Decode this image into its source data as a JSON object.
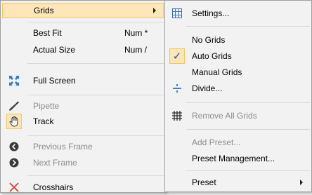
{
  "main_menu": {
    "items": [
      {
        "label": "Grids"
      },
      {
        "label": "Best Fit",
        "shortcut": "Num *"
      },
      {
        "label": "Actual Size",
        "shortcut": "Num /"
      },
      {
        "label": "Full Screen",
        "icon": "fullscreen-icon"
      },
      {
        "label": "Pipette",
        "icon": "pipette-icon",
        "disabled": true
      },
      {
        "label": "Track",
        "icon": "hand-icon"
      },
      {
        "label": "Previous Frame",
        "icon": "previous-frame-icon",
        "disabled": true
      },
      {
        "label": "Next Frame",
        "icon": "next-frame-icon",
        "disabled": true
      },
      {
        "label": "Crosshairs",
        "icon": "crosshairs-icon"
      }
    ]
  },
  "grids_submenu": {
    "items": [
      {
        "label": "Settings...",
        "icon": "grid-settings-icon"
      },
      {
        "label": "No Grids"
      },
      {
        "label": "Auto Grids",
        "checked": true,
        "check_symbol": "✓"
      },
      {
        "label": "Manual Grids"
      },
      {
        "label": "Divide...",
        "icon": "divide-icon"
      },
      {
        "label": "Remove All Grids",
        "icon": "remove-grids-icon",
        "disabled": true
      },
      {
        "label": "Add Preset...",
        "disabled": true
      },
      {
        "label": "Preset Management..."
      },
      {
        "label": "Preset"
      }
    ]
  },
  "colors": {
    "highlight_bg": "#fde6b8",
    "highlight_border": "#f2c56a",
    "disabled_text": "#8c8c8c",
    "accent_blue": "#1a58b0"
  }
}
